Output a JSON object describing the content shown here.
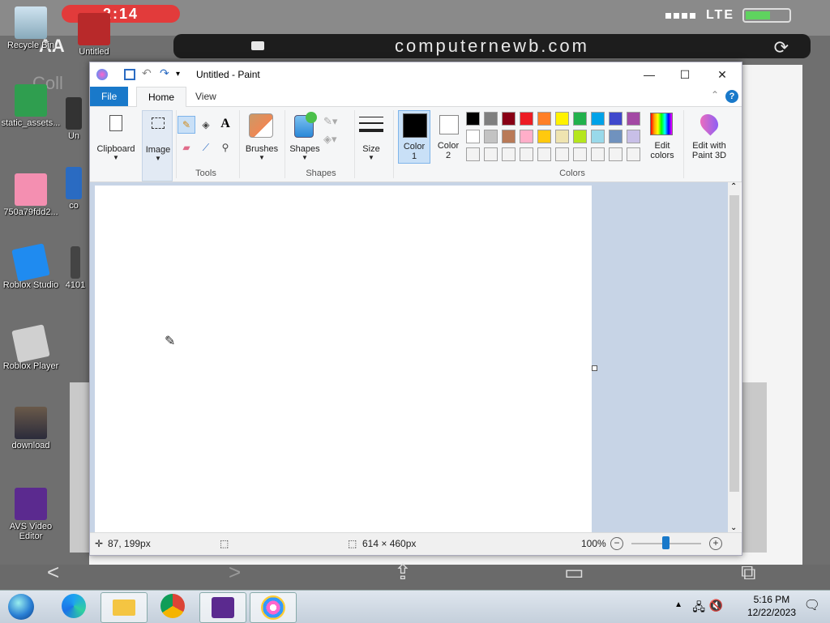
{
  "ios": {
    "time": "2:14",
    "network": "LTE",
    "text_size_label": "AA",
    "url": "computernewb.com",
    "page_heading_fragment": "Coll"
  },
  "desktop": {
    "icons": [
      {
        "label": "Recycle Bin",
        "icon": "recycle-bin-icon"
      },
      {
        "label": "Untitled",
        "icon": "image-file-icon"
      },
      {
        "label": "static_assets...",
        "icon": "file-icon"
      },
      {
        "label": "Un",
        "icon": "video-file-icon"
      },
      {
        "label": "750a79fdd2...",
        "icon": "image-file-icon"
      },
      {
        "label": "co",
        "icon": "file-icon"
      },
      {
        "label": "Roblox Studio",
        "icon": "roblox-studio-icon"
      },
      {
        "label": "4101",
        "icon": "file-icon"
      },
      {
        "label": "Roblox Player",
        "icon": "roblox-player-icon"
      },
      {
        "label": "download",
        "icon": "image-file-icon"
      },
      {
        "label": "AVS Video Editor",
        "icon": "avs-video-editor-icon"
      }
    ]
  },
  "paint": {
    "title": "Untitled - Paint",
    "tabs": {
      "file": "File",
      "home": "Home",
      "view": "View"
    },
    "help": "?",
    "ribbon": {
      "clipboard": "Clipboard",
      "image": "Image",
      "tools": "Tools",
      "brushes": "Brushes",
      "shapes": "Shapes",
      "shapes_group": "Shapes",
      "size": "Size",
      "color1_line1": "Color",
      "color1_line2": "1",
      "color2_line1": "Color",
      "color2_line2": "2",
      "colors_group": "Colors",
      "edit_colors_line1": "Edit",
      "edit_colors_line2": "colors",
      "edit_paint3d_line1": "Edit with",
      "edit_paint3d_line2": "Paint 3D"
    },
    "color1": "#000000",
    "color2": "#ffffff",
    "palette_row1": [
      "#000000",
      "#7f7f7f",
      "#880015",
      "#ed1c24",
      "#ff7f27",
      "#fff200",
      "#22b14c",
      "#00a2e8",
      "#3f48cc",
      "#a349a4"
    ],
    "palette_row2": [
      "#ffffff",
      "#c3c3c3",
      "#b97a57",
      "#ffaec9",
      "#ffc90e",
      "#efe4b0",
      "#b5e61d",
      "#99d9ea",
      "#7092be",
      "#c8bfe7"
    ],
    "status": {
      "cursor_pos": "87, 199px",
      "canvas_size": "614 × 460px",
      "zoom": "100%"
    }
  },
  "taskbar": {
    "apps": [
      "start-orb",
      "edge-icon",
      "file-explorer-icon",
      "chrome-icon",
      "video-editor-icon",
      "paint-icon"
    ],
    "time": "5:16 PM",
    "date": "12/22/2023"
  }
}
